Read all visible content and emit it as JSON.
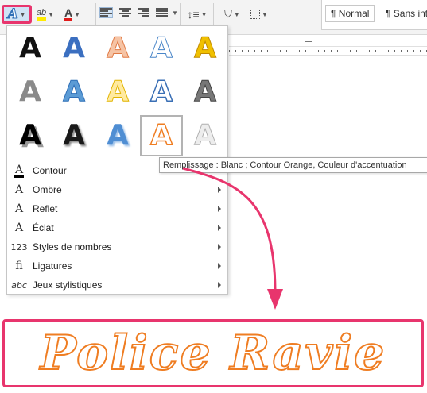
{
  "ribbon": {
    "text_effects_letter": "A",
    "highlight_letter": "ab",
    "font_color_letter": "A",
    "styles": [
      {
        "label": "¶ Normal"
      },
      {
        "label": "¶ Sans int..."
      }
    ]
  },
  "gallery": {
    "letters": [
      {
        "char": "A",
        "style": "black-solid"
      },
      {
        "char": "A",
        "style": "blue-solid"
      },
      {
        "char": "A",
        "style": "peach-outline"
      },
      {
        "char": "A",
        "style": "white-blue-outline"
      },
      {
        "char": "A",
        "style": "gold-solid"
      },
      {
        "char": "A",
        "style": "gray-gradient"
      },
      {
        "char": "A",
        "style": "blue-reflect"
      },
      {
        "char": "A",
        "style": "yellow-outline"
      },
      {
        "char": "A",
        "style": "white-blue-glow"
      },
      {
        "char": "A",
        "style": "gray-bevel"
      },
      {
        "char": "A",
        "style": "black-shadow"
      },
      {
        "char": "A",
        "style": "black-shadow-2"
      },
      {
        "char": "A",
        "style": "blue-shadow"
      },
      {
        "char": "A",
        "style": "white-orange-outline"
      },
      {
        "char": "A",
        "style": "light-gray"
      }
    ],
    "selected_index": 13
  },
  "menu": {
    "items": [
      {
        "icon": "A",
        "label": "Contour",
        "has_submenu": false
      },
      {
        "icon": "A",
        "label": "Ombre",
        "has_submenu": true
      },
      {
        "icon": "A",
        "label": "Reflet",
        "has_submenu": true
      },
      {
        "icon": "A",
        "label": "Éclat",
        "has_submenu": true
      },
      {
        "icon": "123",
        "label": "Styles de nombres",
        "has_submenu": true
      },
      {
        "icon": "fi",
        "label": "Ligatures",
        "has_submenu": true
      },
      {
        "icon": "abc",
        "label": "Jeux stylistiques",
        "has_submenu": true
      }
    ]
  },
  "tooltip": {
    "text": "Remplissage : Blanc ; Contour  Orange, Couleur d'accentuation"
  },
  "result": {
    "text": "Police Ravie"
  },
  "colors": {
    "highlight_frame": "#e8356d",
    "accent_orange": "#ef7d22",
    "accent_blue": "#2f6fb7"
  }
}
